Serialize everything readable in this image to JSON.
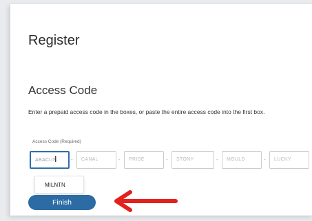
{
  "page": {
    "title": "Register",
    "section_title": "Access Code",
    "instructions": "Enter a prepaid access code in the boxes, or paste the entire access code into the first box."
  },
  "access_code": {
    "label": "Access Code (Required)",
    "boxes": [
      {
        "placeholder": "ABACUS"
      },
      {
        "placeholder": "CANAL"
      },
      {
        "placeholder": "PRIDE"
      },
      {
        "placeholder": "STONY"
      },
      {
        "placeholder": "MOULD"
      },
      {
        "placeholder": "LUCKY"
      }
    ],
    "separator": "-"
  },
  "autocomplete": {
    "suggestion": "MILNTN"
  },
  "actions": {
    "finish_label": "Finish"
  },
  "colors": {
    "accent": "#2c6ba3",
    "arrow": "#e3211c"
  }
}
